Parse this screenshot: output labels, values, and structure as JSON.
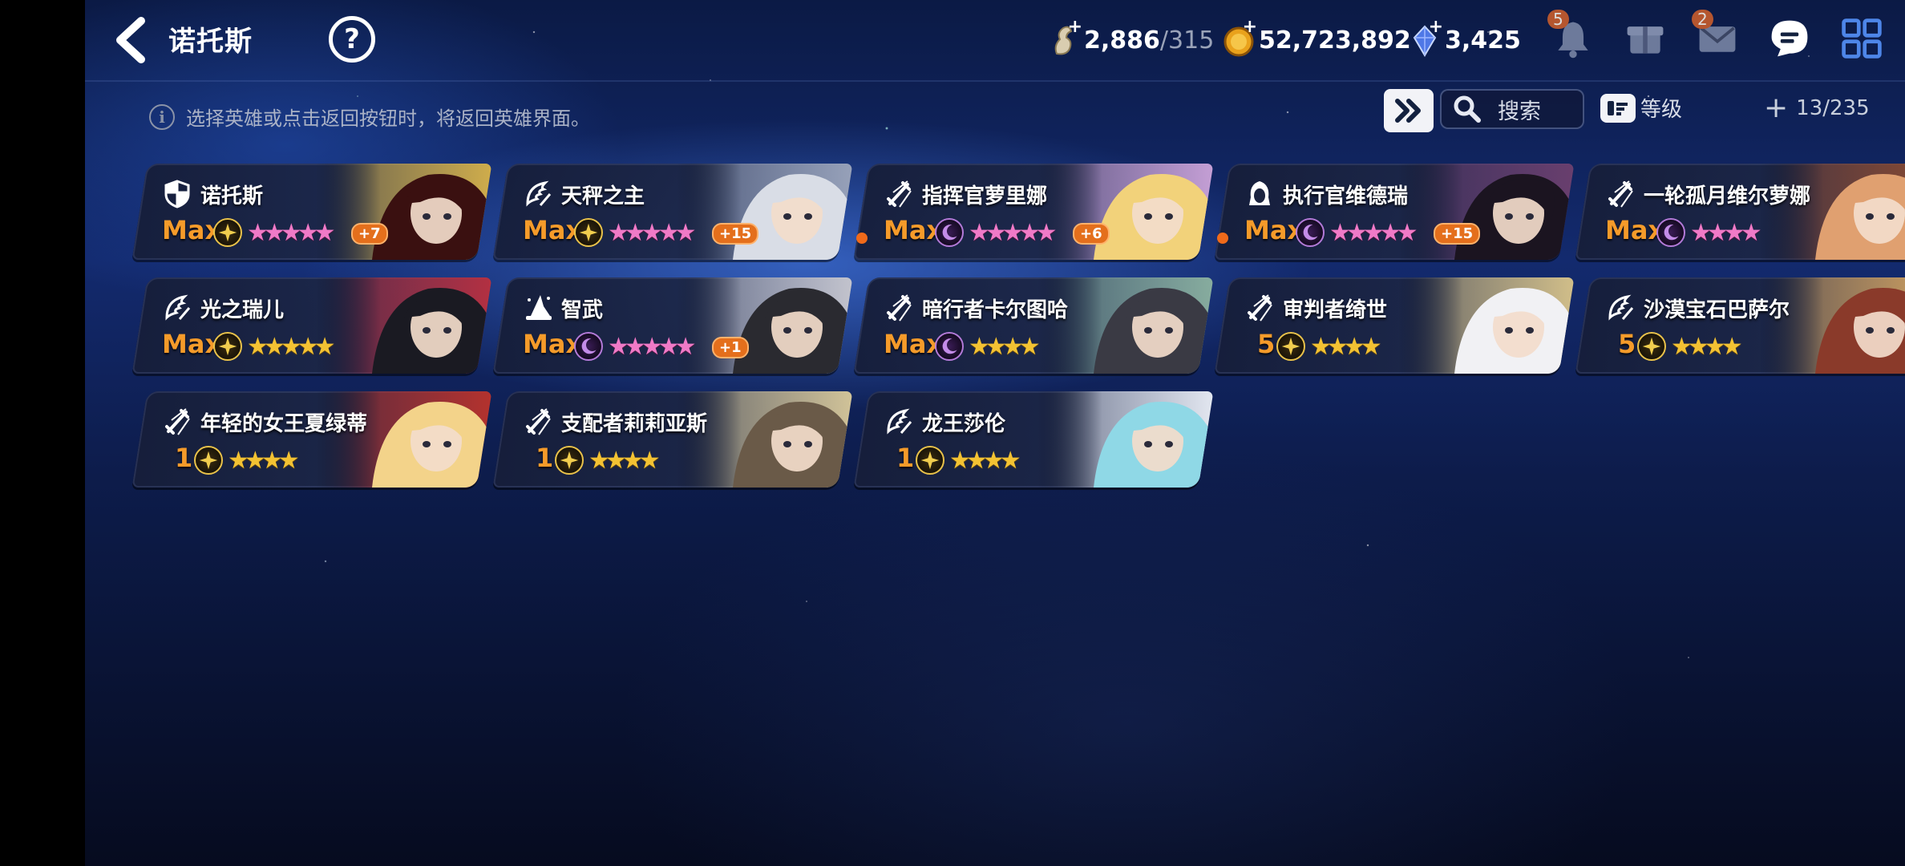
{
  "header": {
    "title": "诺托斯",
    "back_icon": "chevron-left-icon",
    "help_label": "?"
  },
  "resources": {
    "stamina_value": "2,886",
    "stamina_max": "/315",
    "gold_value": "52,723,892",
    "gem_value": "3,425",
    "plus_label": "+"
  },
  "top_icons": {
    "bell_badge": "5",
    "mail_badge": "2"
  },
  "toolbar": {
    "notice": "选择英雄或点击返回按钮时，将返回英雄界面。",
    "search_label": "搜索",
    "sort_label": "等级",
    "count": "13/235"
  },
  "heroes": [
    {
      "name": "诺托斯",
      "level": "Max",
      "plus": "+7",
      "element": "light",
      "class_icon": "shield-icon"
    },
    {
      "name": "天秤之主",
      "level": "Max",
      "plus": "+15",
      "element": "light",
      "class_icon": "wing-icon"
    },
    {
      "name": "指挥官萝里娜",
      "level": "Max",
      "plus": "+6",
      "element": "dark",
      "class_icon": "sword-icon"
    },
    {
      "name": "执行官维德瑞",
      "level": "Max",
      "plus": "+15",
      "element": "dark",
      "class_icon": "hood-icon"
    },
    {
      "name": "一轮孤月维尔萝娜",
      "level": "Max",
      "plus": "",
      "element": "dark",
      "class_icon": "sword-icon"
    },
    {
      "name": "光之瑞儿",
      "level": "Max",
      "plus": "",
      "element": "light",
      "class_icon": "wing-icon"
    },
    {
      "name": "智武",
      "level": "Max",
      "plus": "+1",
      "element": "dark",
      "class_icon": "wizard-hat-icon"
    },
    {
      "name": "暗行者卡尔图哈",
      "level": "Max",
      "plus": "",
      "element": "dark",
      "class_icon": "sword-icon"
    },
    {
      "name": "审判者绮世",
      "level": "5",
      "plus": "",
      "element": "light",
      "class_icon": "sword-icon"
    },
    {
      "name": "沙漠宝石巴萨尔",
      "level": "5",
      "plus": "",
      "element": "light",
      "class_icon": "wing-icon"
    },
    {
      "name": "年轻的女王夏绿蒂",
      "level": "1",
      "plus": "",
      "element": "light",
      "class_icon": "sword-icon"
    },
    {
      "name": "支配者莉莉亚斯",
      "level": "1",
      "plus": "",
      "element": "light",
      "class_icon": "sword-icon"
    },
    {
      "name": "龙王莎伦",
      "level": "1",
      "plus": "",
      "element": "light",
      "class_icon": "wing-icon"
    }
  ],
  "colors": {
    "level_orange": "#f59b2a",
    "star_gold": "#f3c233",
    "star_pink": "#f07ac7",
    "notify_dot": "#f06a1a"
  }
}
